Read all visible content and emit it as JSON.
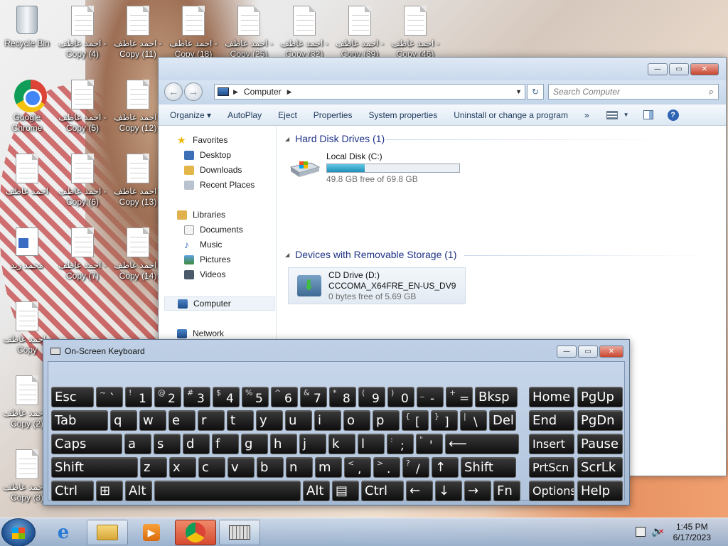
{
  "desktop": {
    "icons": [
      {
        "label": "Recycle Bin",
        "type": "bin"
      },
      {
        "label": "احمد عاطف - Copy (4)",
        "type": "doc"
      },
      {
        "label": "احمد عاطف - Copy (11)",
        "type": "doc"
      },
      {
        "label": "احمد عاطف - Copy (18)",
        "type": "doc"
      },
      {
        "label": "احمد عاطف - Copy (25)",
        "type": "doc"
      },
      {
        "label": "احمد عاطف - Copy (32)",
        "type": "doc"
      },
      {
        "label": "احمد عاطف - Copy (39)",
        "type": "doc"
      },
      {
        "label": "احمد عاطف - Copy (46)",
        "type": "doc"
      },
      {
        "label": "Google Chrome",
        "type": "chrome"
      },
      {
        "label": "احمد عاطف - Copy (5)",
        "type": "doc"
      },
      {
        "label": "احمد عاطف - Copy (12)",
        "type": "doc"
      },
      {
        "label": "احمد عاطف",
        "type": "doc"
      },
      {
        "label": "احمد عاطف - Copy (6)",
        "type": "doc"
      },
      {
        "label": "احمد عاطف - Copy (13)",
        "type": "doc"
      },
      {
        "label": "محمد زيد",
        "type": "wordpad"
      },
      {
        "label": "احمد عاطف - Copy (7)",
        "type": "doc"
      },
      {
        "label": "احمد عاطف - Copy (14)",
        "type": "doc"
      },
      {
        "label": "احمد عاطف - Copy",
        "type": "doc"
      },
      {
        "label": "احمد عاطف - Copy (2)",
        "type": "doc"
      },
      {
        "label": "احمد عاطف - Copy (3)",
        "type": "doc"
      }
    ]
  },
  "explorer": {
    "address": "Computer",
    "search_placeholder": "Search Computer",
    "toolbar": [
      "Organize ▾",
      "AutoPlay",
      "Eject",
      "Properties",
      "System properties",
      "Uninstall or change a program"
    ],
    "more": "»",
    "nav": {
      "favorites": "Favorites",
      "desktop": "Desktop",
      "downloads": "Downloads",
      "recent": "Recent Places",
      "libraries": "Libraries",
      "documents": "Documents",
      "music": "Music",
      "pictures": "Pictures",
      "videos": "Videos",
      "computer": "Computer",
      "network": "Network"
    },
    "groups": {
      "hdd": "Hard Disk Drives (1)",
      "removable": "Devices with Removable Storage (1)"
    },
    "local_disk": {
      "name": "Local Disk (C:)",
      "free": "49.8 GB free of 69.8 GB",
      "used_fraction": 0.287
    },
    "cd_drive": {
      "name": "CD Drive (D:)",
      "label": "CCCOMA_X64FRE_EN-US_DV9",
      "free": "0 bytes free of 5.69 GB"
    }
  },
  "osk": {
    "title": "On-Screen Keyboard",
    "rows": [
      [
        [
          "Esc",
          ""
        ],
        [
          "`",
          "~"
        ],
        [
          "1",
          "!"
        ],
        [
          "2",
          "@"
        ],
        [
          "3",
          "#"
        ],
        [
          "4",
          "$"
        ],
        [
          "5",
          "%"
        ],
        [
          "6",
          "^"
        ],
        [
          "7",
          "&"
        ],
        [
          "8",
          "*"
        ],
        [
          "9",
          "("
        ],
        [
          "0",
          ")"
        ],
        [
          "-",
          "_"
        ],
        [
          "=",
          "+"
        ],
        [
          "Bksp",
          ""
        ],
        [
          "Home",
          ""
        ],
        [
          "PgUp",
          ""
        ]
      ],
      [
        [
          "Tab",
          ""
        ],
        [
          "q",
          ""
        ],
        [
          "w",
          ""
        ],
        [
          "e",
          ""
        ],
        [
          "r",
          ""
        ],
        [
          "t",
          ""
        ],
        [
          "y",
          ""
        ],
        [
          "u",
          ""
        ],
        [
          "i",
          ""
        ],
        [
          "o",
          ""
        ],
        [
          "p",
          ""
        ],
        [
          "[",
          "{"
        ],
        [
          "]",
          "}"
        ],
        [
          "\\",
          "|"
        ],
        [
          "Del",
          ""
        ],
        [
          "End",
          ""
        ],
        [
          "PgDn",
          ""
        ]
      ],
      [
        [
          "Caps",
          ""
        ],
        [
          "a",
          ""
        ],
        [
          "s",
          ""
        ],
        [
          "d",
          ""
        ],
        [
          "f",
          ""
        ],
        [
          "g",
          ""
        ],
        [
          "h",
          ""
        ],
        [
          "j",
          ""
        ],
        [
          "k",
          ""
        ],
        [
          "l",
          ""
        ],
        [
          ";",
          ":"
        ],
        [
          "'",
          "\""
        ],
        [
          "⟵",
          ""
        ],
        [
          "Insert",
          ""
        ],
        [
          "Pause",
          ""
        ]
      ],
      [
        [
          "Shift",
          ""
        ],
        [
          "z",
          ""
        ],
        [
          "x",
          ""
        ],
        [
          "c",
          ""
        ],
        [
          "v",
          ""
        ],
        [
          "b",
          ""
        ],
        [
          "n",
          ""
        ],
        [
          "m",
          ""
        ],
        [
          ",",
          "<"
        ],
        [
          ".",
          ">"
        ],
        [
          "/",
          "?"
        ],
        [
          "↑",
          ""
        ],
        [
          "Shift",
          ""
        ],
        [
          "PrtScn",
          ""
        ],
        [
          "ScrLk",
          ""
        ]
      ],
      [
        [
          "Ctrl",
          ""
        ],
        [
          "⊞",
          ""
        ],
        [
          "Alt",
          ""
        ],
        [
          "",
          ""
        ],
        [
          "Alt",
          ""
        ],
        [
          "▤",
          ""
        ],
        [
          "Ctrl",
          ""
        ],
        [
          "←",
          ""
        ],
        [
          "↓",
          ""
        ],
        [
          "→",
          ""
        ],
        [
          "Fn",
          ""
        ],
        [
          "Options",
          ""
        ],
        [
          "Help",
          ""
        ]
      ]
    ]
  },
  "taskbar": {
    "time": "1:45 PM",
    "date": "6/17/2023"
  }
}
